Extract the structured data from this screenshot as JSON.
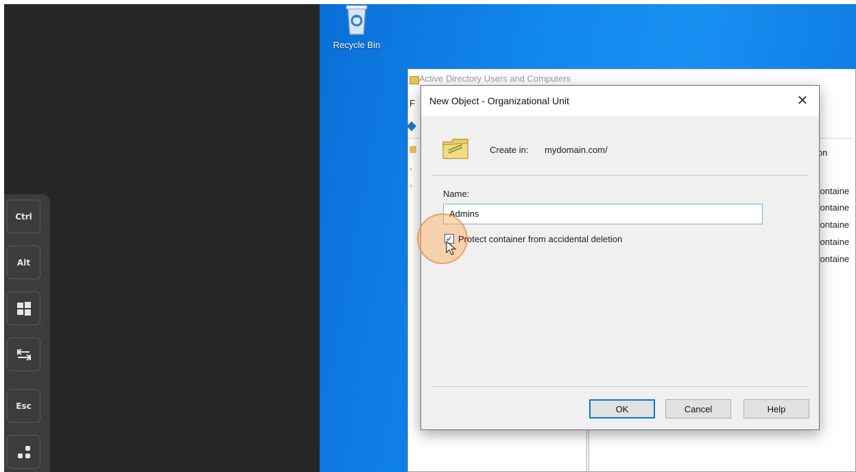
{
  "desktop": {
    "recycle_bin_label": "Recycle Bin"
  },
  "keybar": {
    "keys": [
      "Ctrl",
      "Alt",
      "win-key-icon",
      "tab-key-icon",
      "Esc",
      "more-icon"
    ],
    "ctrl_label": "Ctrl",
    "alt_label": "Alt",
    "esc_label": "Esc"
  },
  "aduc": {
    "title": "Active Directory Users and Computers",
    "menu_first_letter": "F",
    "column_header": "ion",
    "cells": [
      "containe",
      "containe",
      "containe",
      "containe",
      "containe"
    ]
  },
  "dialog": {
    "title": "New Object - Organizational Unit",
    "close_glyph": "✕",
    "create_in_label": "Create in:",
    "create_in_value": "mydomain.com/",
    "name_label": "Name:",
    "name_value": "Admins",
    "protect_checked": true,
    "protect_label": "Protect container from accidental deletion",
    "ok_label": "OK",
    "cancel_label": "Cancel",
    "help_label": "Help"
  },
  "colors": {
    "desktop_blue": "#1186ec",
    "dialog_bg": "#f0f0f0",
    "highlight": "#f6a45a",
    "focus_border": "#0078d7"
  }
}
